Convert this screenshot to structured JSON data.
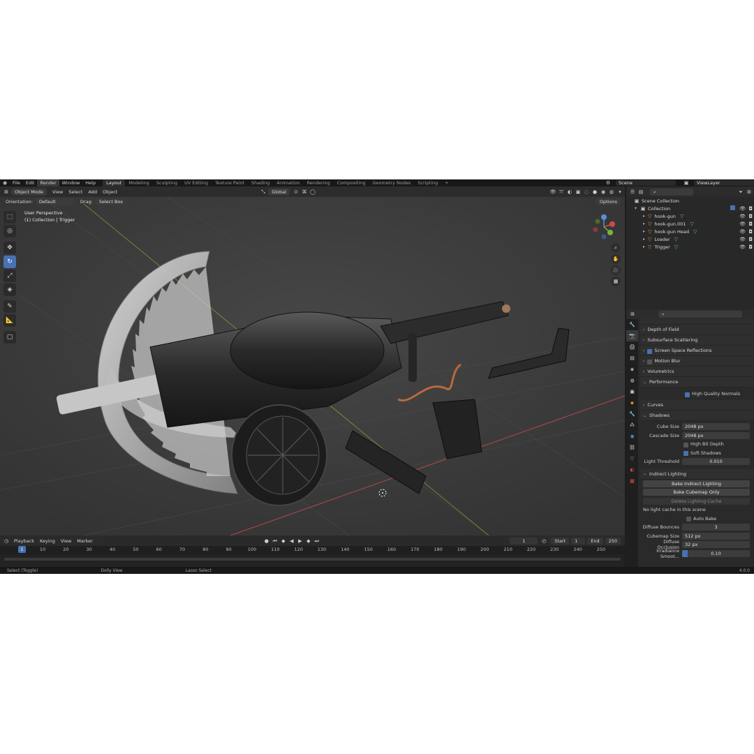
{
  "topbar": {
    "menus": [
      "File",
      "Edit",
      "Render",
      "Window",
      "Help"
    ],
    "workspaces": [
      "Layout",
      "Modeling",
      "Sculpting",
      "UV Editing",
      "Texture Paint",
      "Shading",
      "Animation",
      "Rendering",
      "Compositing",
      "Geometry Nodes",
      "Scripting"
    ],
    "scene": "Scene",
    "view_layer": "ViewLayer"
  },
  "viewport_header": {
    "mode": "Object Mode",
    "menus": [
      "View",
      "Select",
      "Add",
      "Object"
    ],
    "transform": "Global",
    "orientation_label": "Orientation:",
    "orientation_value": "Default",
    "drag_label": "Drag:",
    "drag_value": "Select Box",
    "options": "Options"
  },
  "viewport": {
    "view_name": "User Perspective",
    "collection_info": "(1) Collection | Trigger",
    "gizmo_axes": [
      "X",
      "Y",
      "Z"
    ]
  },
  "timeline": {
    "menus": [
      "Playback",
      "Keying",
      "View",
      "Marker"
    ],
    "current_frame": "1",
    "start_label": "Start",
    "start": "1",
    "end_label": "End",
    "end": "250",
    "ticks": [
      "1",
      "10",
      "20",
      "30",
      "40",
      "50",
      "60",
      "70",
      "80",
      "90",
      "100",
      "110",
      "120",
      "130",
      "140",
      "150",
      "160",
      "170",
      "180",
      "190",
      "200",
      "210",
      "220",
      "230",
      "240",
      "250"
    ]
  },
  "statusbar": {
    "items": [
      "Select (Toggle)",
      "Dolly View",
      "Lasso Select"
    ],
    "version": "4.0.0"
  },
  "outliner": {
    "root": "Scene Collection",
    "collection": "Collection",
    "objects": [
      "hook-gun",
      "hook-gun.001",
      "hook-gun Head",
      "Loader",
      "Trigger"
    ]
  },
  "properties": {
    "sections_top": [
      {
        "label": "Depth of Field",
        "check": null
      },
      {
        "label": "Subsurface Scattering",
        "check": null
      },
      {
        "label": "Screen Space Reflections",
        "check": true
      },
      {
        "label": "Motion Blur",
        "check": false
      },
      {
        "label": "Volumetrics",
        "check": null
      },
      {
        "label": "Performance",
        "check": null
      }
    ],
    "performance_option": "High Quality Normals",
    "curves": "Curves",
    "shadows": "Shadows",
    "cube_size_label": "Cube Size",
    "cube_size": "2048 px",
    "cascade_size_label": "Cascade Size",
    "cascade_size": "2048 px",
    "high_bit_depth": "High Bit Depth",
    "soft_shadows": "Soft Shadows",
    "light_threshold_label": "Light Threshold",
    "light_threshold": "0.010",
    "indirect": "Indirect Lighting",
    "bake_indirect": "Bake Indirect Lighting",
    "bake_cubemap": "Bake Cubemap Only",
    "delete_cache": "Delete Lighting Cache",
    "no_cache": "No light cache in this scene",
    "auto_bake": "Auto Bake",
    "diffuse_bounces_label": "Diffuse Bounces",
    "diffuse_bounces": "3",
    "cubemap_size_label": "Cubemap Size",
    "cubemap_size": "512 px",
    "diffuse_occlusion_label": "Diffuse Occlusion",
    "diffuse_occlusion": "32 px",
    "irradiance_label": "Irradiance Smoot...",
    "irradiance": "0.10"
  },
  "colors": {
    "accent": "#4772b3",
    "object_icon": "#e2903d",
    "mesh_data_icon": "#5ec27a"
  }
}
